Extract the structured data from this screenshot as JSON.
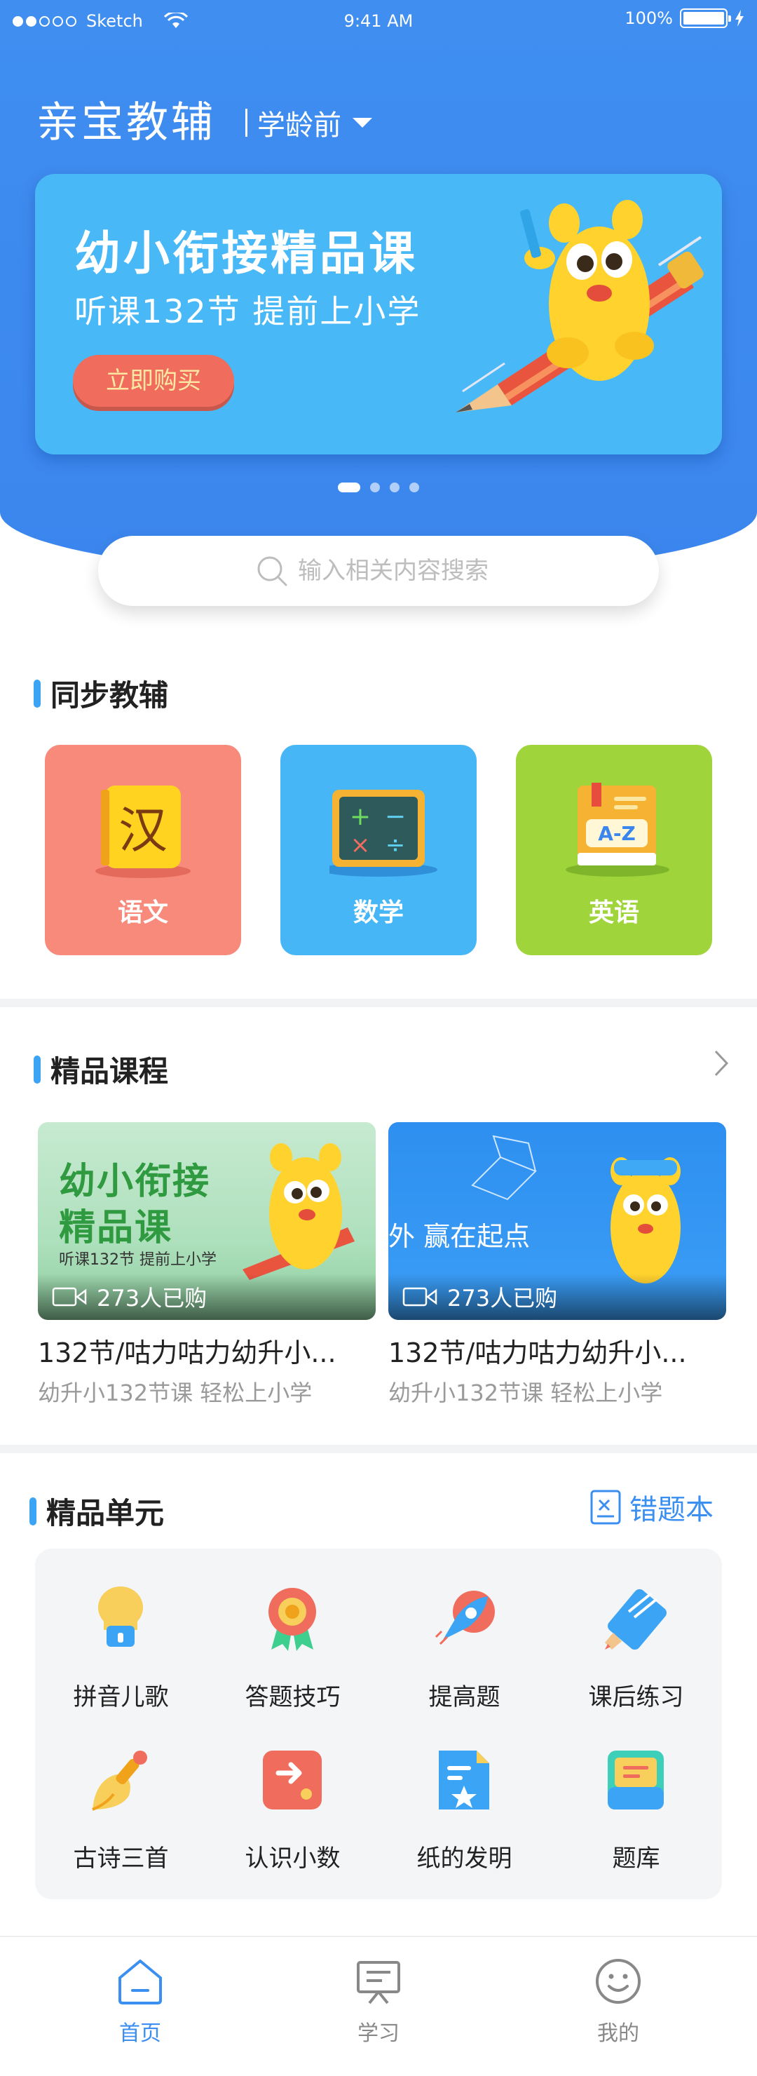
{
  "status_bar": {
    "carrier": "Sketch",
    "time": "9:41 AM",
    "battery": "100%"
  },
  "header": {
    "title": "亲宝教辅",
    "grade": "学龄前"
  },
  "banner": {
    "title": "幼小衔接精品课",
    "subtitle": "听课132节 提前上小学",
    "button": "立即购买",
    "page_count": 4,
    "active_page": 1
  },
  "search": {
    "placeholder": "输入相关内容搜索"
  },
  "sync": {
    "title": "同步教辅",
    "subjects": [
      {
        "label": "语文",
        "glyph": "汉",
        "color": "#f78a7a",
        "icon": "chinese-book-icon"
      },
      {
        "label": "数学",
        "color": "#46b6f6",
        "icon": "math-board-icon"
      },
      {
        "label": "英语",
        "glyph": "A-Z",
        "color": "#9fd53a",
        "icon": "english-book-icon"
      }
    ]
  },
  "courses": {
    "title": "精品课程",
    "items": [
      {
        "thumb_title": "幼小衔接",
        "thumb_title2": "精品课",
        "thumb_sub": "听课132节 提前上小学",
        "buyers": "273人已购",
        "name": "132节/咕力咕力幼升小...",
        "desc": "幼升小132节课 轻松上小学"
      },
      {
        "thumb_title": "外 赢在起点",
        "buyers": "273人已购",
        "name": "132节/咕力咕力幼升小...",
        "desc": "幼升小132节课 轻松上小学"
      }
    ]
  },
  "units": {
    "title": "精品单元",
    "wrong_book": "错题本",
    "items": [
      {
        "label": "拼音儿歌",
        "icon": "lightbulb-icon"
      },
      {
        "label": "答题技巧",
        "icon": "medal-icon"
      },
      {
        "label": "提高题",
        "icon": "rocket-icon"
      },
      {
        "label": "课后练习",
        "icon": "pencil-card-icon"
      },
      {
        "label": "古诗三首",
        "icon": "brush-icon"
      },
      {
        "label": "认识小数",
        "icon": "arrow-card-icon"
      },
      {
        "label": "纸的发明",
        "icon": "document-star-icon"
      },
      {
        "label": "题库",
        "icon": "question-bank-icon"
      }
    ]
  },
  "tabbar": {
    "items": [
      {
        "label": "首页",
        "icon": "home-icon",
        "active": true
      },
      {
        "label": "学习",
        "icon": "study-board-icon",
        "active": false
      },
      {
        "label": "我的",
        "icon": "smiley-icon",
        "active": false
      }
    ]
  },
  "colors": {
    "primary": "#3b86ee",
    "accent": "#3a8ff0",
    "banner": "#49b8f6",
    "cta": "#f06d5e"
  }
}
